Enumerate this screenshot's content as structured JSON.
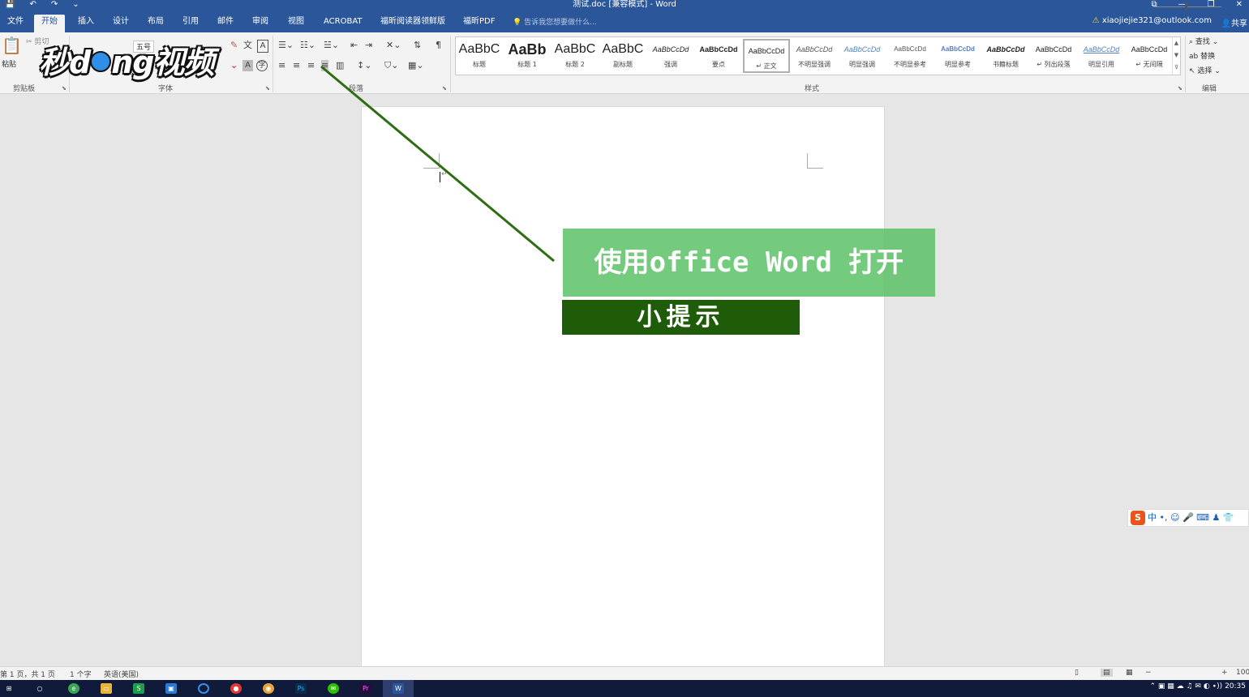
{
  "window": {
    "title": "测试.doc [兼容模式] - Word",
    "quick_access": [
      "💾",
      "↶",
      "↷",
      "⌄"
    ],
    "controls": [
      "⧉",
      "—",
      "❐",
      "✕"
    ]
  },
  "tabs": [
    {
      "label": "文件"
    },
    {
      "label": "开始"
    },
    {
      "label": "插入"
    },
    {
      "label": "设计"
    },
    {
      "label": "布局"
    },
    {
      "label": "引用"
    },
    {
      "label": "邮件"
    },
    {
      "label": "审阅"
    },
    {
      "label": "视图"
    },
    {
      "label": "ACROBAT"
    },
    {
      "label": "福昕阅读器领鲜版"
    },
    {
      "label": "福昕PDF"
    }
  ],
  "active_tab": "开始",
  "tell_me": "告诉我您想要做什么...",
  "account": "xiaojiejie321@outlook.com",
  "share": "共享",
  "ribbon": {
    "clipboard": {
      "label": "剪贴板",
      "paste": "粘贴",
      "cut": "剪切"
    },
    "font": {
      "label": "字体",
      "size": "五号"
    },
    "paragraph": {
      "label": "段落"
    },
    "styles": {
      "label": "样式",
      "items": [
        {
          "preview": "AaBbC",
          "name": "标题"
        },
        {
          "preview": "AaBb",
          "name": "标题 1"
        },
        {
          "preview": "AaBbC",
          "name": "标题 2"
        },
        {
          "preview": "AaBbC",
          "name": "副标题"
        },
        {
          "preview": "AaBbCcDd",
          "name": "强调"
        },
        {
          "preview": "AaBbCcDd",
          "name": "要点"
        },
        {
          "preview": "AaBbCcDd",
          "name": "↵ 正文"
        },
        {
          "preview": "AaBbCcDd",
          "name": "不明显强调"
        },
        {
          "preview": "AaBbCcDd",
          "name": "明显强调"
        },
        {
          "preview": "AaBbCcDd",
          "name": "不明显参考"
        },
        {
          "preview": "AaBbCcDd",
          "name": "明显参考"
        },
        {
          "preview": "AaBbCcDd",
          "name": "书籍标题"
        },
        {
          "preview": "AaBbCcDd",
          "name": "↵ 列出段落"
        },
        {
          "preview": "AaBbCcDd",
          "name": "明显引用"
        },
        {
          "preview": "AaBbCcDd",
          "name": "↵ 无间隔"
        }
      ]
    },
    "editing": {
      "label": "编辑",
      "find": "查找",
      "replace": "替换",
      "select": "选择"
    }
  },
  "logo": {
    "text_before": "秒d",
    "text_after": "ng视频"
  },
  "overlay": {
    "main": "使用office Word 打开",
    "sub": "小提示"
  },
  "status": {
    "page": "第 1 页，共 1 页",
    "words": "1 个字",
    "language": "英语(美国)",
    "zoom": "100"
  },
  "ime": {
    "brand": "S",
    "text": "中 •, ☺ 🎤 ⌨ ♟ 👕"
  },
  "clock": "20:35",
  "colors": {
    "word_blue": "#2b579a",
    "tip_green": "#56be60",
    "tip_dark": "#1f5c0a"
  }
}
